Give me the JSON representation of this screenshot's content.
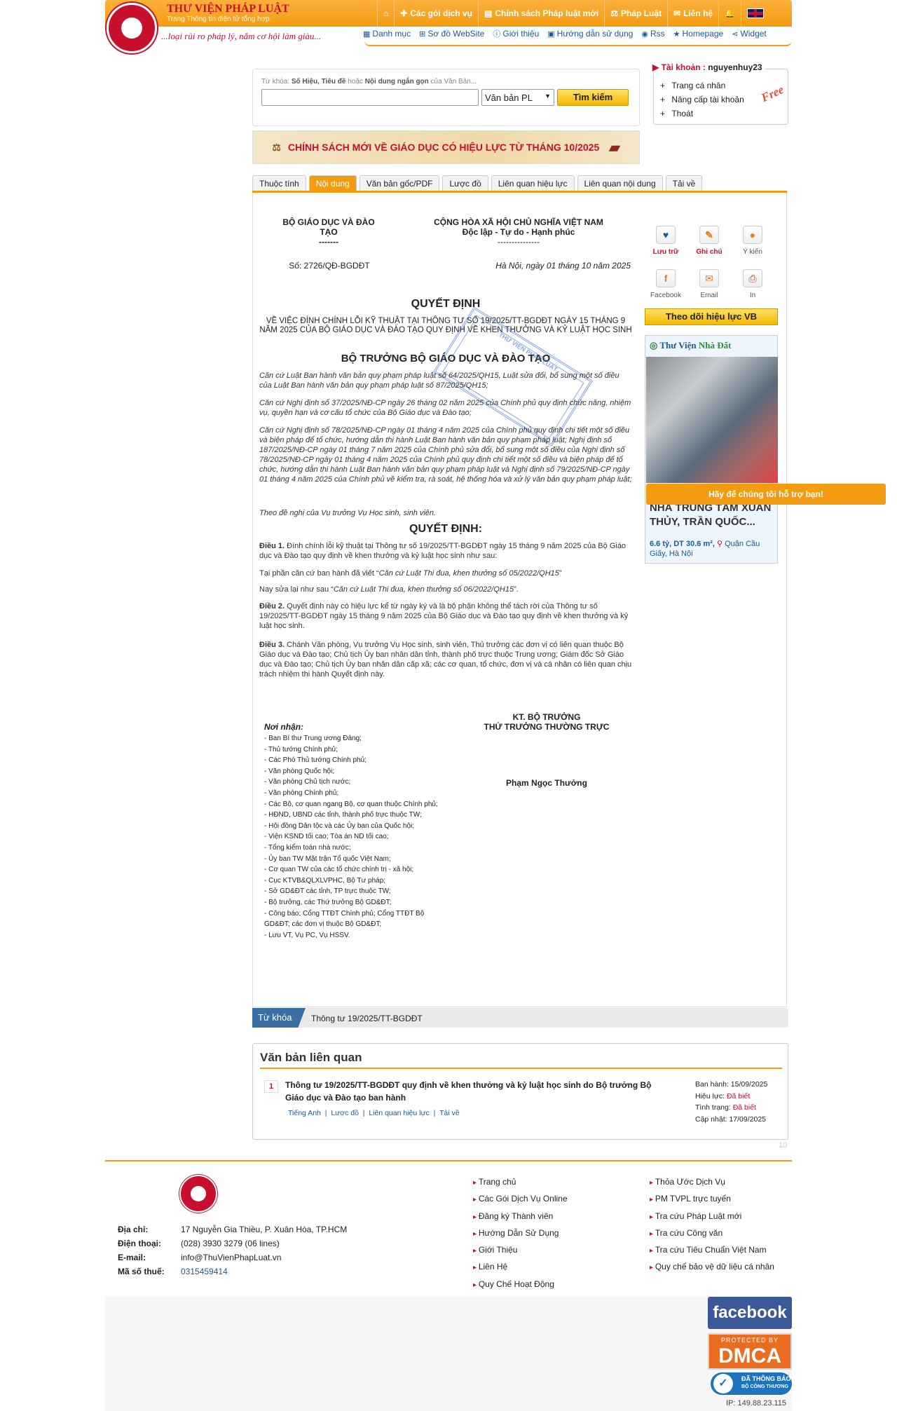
{
  "header": {
    "brand": "THƯ VIỆN PHÁP LUẬT",
    "brand_sub": "Trang Thông tin điện tử tổng hợp",
    "slogan": "...loại rủi ro pháp lý, nắm cơ hội làm giàu...",
    "top_nav": [
      "Các gói dịch vụ",
      "Chính sách Pháp luật mới",
      "Pháp Luật",
      "Liên hệ"
    ],
    "sub_nav": [
      "Danh mục",
      "Sơ đồ WebSite",
      "Giới thiệu",
      "Hướng dẫn sử dụng",
      "Rss",
      "Homepage",
      "Widget"
    ]
  },
  "search": {
    "hint_pre": "Từ khóa: ",
    "hint_b1": "Số Hiệu, Tiêu đề",
    "hint_mid": " hoặc ",
    "hint_b2": "Nội dung ngắn gọn",
    "hint_post": " của Văn Bản...",
    "type": "Văn bản PL",
    "button": "Tìm kiếm"
  },
  "account": {
    "label": "Tài khoản : ",
    "username": "nguyenhuy23",
    "items": [
      "Trang cá nhân",
      "Nâng cấp tài khoản",
      "Thoát"
    ],
    "free": "Free"
  },
  "banner": "CHÍNH SÁCH MỚI VỀ GIÁO DỤC CÓ HIỆU LỰC TỪ THÁNG 10/2025",
  "tabs": [
    "Thuộc tính",
    "Nội dung",
    "Văn bản gốc/PDF",
    "Lược đồ",
    "Liên quan hiệu lực",
    "Liên quan nội dung",
    "Tải về"
  ],
  "doc": {
    "org": "BỘ GIÁO DỤC VÀ ĐÀO TẠO",
    "org_sep": "-------",
    "nation": "CỘNG HÒA XÃ HỘI CHỦ NGHĨA VIỆT NAM",
    "motto": "Độc lập - Tự do - Hạnh phúc",
    "motto_sep": "---------------",
    "number": "Số: 2726/QĐ-BGDĐT",
    "date": "Hà Nội, ngày 01 tháng 10 năm 2025",
    "title": "QUYẾT ĐỊNH",
    "subtitle": "VỀ VIỆC ĐÍNH CHÍNH LỖI KỸ THUẬT TẠI THÔNG TƯ SỐ 19/2025/TT-BGDĐT NGÀY 15 THÁNG 9 NĂM 2025 CỦA BỘ GIÁO DỤC VÀ ĐÀO TẠO QUY ĐỊNH VỀ KHEN THƯỞNG VÀ KỶ LUẬT HỌC SINH",
    "authority": "BỘ TRƯỞNG BỘ GIÁO DỤC VÀ ĐÀO TẠO",
    "bases": [
      "Căn cứ Luật Ban hành văn bản quy phạm pháp luật số 64/2025/QH15, Luật sửa đổi, bổ sung một số điều của Luật Ban hành văn bản quy phạm pháp luật số 87/2025/QH15;",
      "Căn cứ Nghị định số 37/2025/NĐ-CP ngày 26 tháng 02 năm 2025 của Chính phủ quy định chức năng, nhiệm vụ, quyền hạn và cơ cấu tổ chức của Bộ Giáo dục và Đào tạo;",
      "Căn cứ Nghị định số 78/2025/NĐ-CP ngày 01 tháng 4 năm 2025 của Chính phủ quy định chi tiết một số điều và biện pháp để tổ chức, hướng dẫn thi hành Luật Ban hành văn bản quy phạm pháp luật; Nghị định số 187/2025/NĐ-CP ngày 01 tháng 7 năm 2025 của Chính phủ sửa đổi, bổ sung một số điều của Nghị định số 78/2025/NĐ-CP ngày 01 tháng 4 năm 2025 của Chính phủ quy định chi tiết một số điều và biện pháp để tổ chức, hướng dẫn thi hành Luật Ban hành văn bản quy phạm pháp luật và Nghị định số 79/2025/NĐ-CP ngày 01 tháng 4 năm 2025 của Chính phủ về kiểm tra, rà soát, hệ thống hóa và xử lý văn bản quy phạm pháp luật;",
      "Theo đề nghị của Vụ trưởng Vụ Học sinh, sinh viên."
    ],
    "decide": "QUYẾT ĐỊNH:",
    "art1_label": "Điều 1.",
    "art1": " Đính chính lỗi kỹ thuật tại Thông tư số 19/2025/TT-BGDĐT ngày 15 tháng 9 năm 2025 của Bộ Giáo dục và Đào tạo quy định về khen thưởng và kỷ luật học sinh như sau:",
    "art1_a_pre": "Tại phần căn cứ ban hành đã viết “",
    "art1_a_it": "Căn cứ Luật Thi đua, khen thưởng số 05/2022/QH15",
    "art1_a_post": "”",
    "art1_b_pre": "Nay sửa lại như sau “",
    "art1_b_it": "Căn cứ Luật Thi đua, khen thưởng số 06/2022/QH15",
    "art1_b_post": "”.",
    "art2_label": "Điều 2.",
    "art2": " Quyết định này có hiệu lực kể từ ngày ký và là bộ phận không thể tách rời của Thông tư số 19/2025/TT-BGDĐT ngày 15 tháng 9 năm 2025 của Bộ Giáo dục và Đào tạo quy định về khen thưởng và kỷ luật học sinh.",
    "art3_label": "Điều 3.",
    "art3": " Chánh Văn phòng, Vụ trưởng Vụ Học sinh, sinh viên, Thủ trưởng các đơn vị có liên quan thuộc Bộ Giáo dục và Đào tạo; Chủ tịch Ủy ban nhân dân tỉnh, thành phố trực thuộc Trung ương; Giám đốc Sở Giáo dục và Đào tạo; Chủ tịch Ủy ban nhân dân cấp xã; các cơ quan, tổ chức, đơn vị và cá nhân có liên quan chịu trách nhiệm thi hành Quyết định này.",
    "stamp": "THƯ VIỆN PHÁP LUẬT",
    "sign_1": "KT. BỘ TRƯỞNG",
    "sign_2": "THỨ TRƯỞNG THƯỜNG TRỰC",
    "signer": "Phạm Ngọc Thưởng",
    "recv_title": "Nơi nhận:",
    "recipients": [
      "- Ban Bí thư Trung ương Đảng;",
      "- Thủ tướng Chính phủ;",
      "- Các Phó Thủ tướng Chính phủ;",
      "- Văn phòng Quốc hội;",
      "- Văn phòng Chủ tịch nước;",
      "- Văn phòng Chính phủ;",
      "- Các Bộ, cơ quan ngang Bộ, cơ quan thuộc Chính phủ;",
      "- HĐND, UBND các tỉnh, thành phố trực thuộc TW;",
      "- Hội đồng Dân tộc và các Ủy ban của Quốc hội;",
      "- Viện KSND tối cao; Tòa án ND tối cao;",
      "- Tổng kiểm toán nhà nước;",
      "- Ủy ban TW Mặt trận Tổ quốc Việt Nam;",
      "- Cơ quan TW của các tổ chức chính trị - xã hội;",
      "- Cục KTVB&QLXLVPHC, Bộ Tư pháp;",
      "- Sở GD&ĐT các tỉnh, TP trực thuộc TW;",
      "- Bộ trưởng, các Thứ trưởng Bộ GD&ĐT;",
      "- Công báo; Cổng TTĐT Chính phủ; Cổng TTĐT Bộ GD&ĐT; các đơn vị thuộc Bộ GD&ĐT;",
      "- Lưu VT, Vụ PC, Vụ HSSV."
    ]
  },
  "tools": {
    "items": [
      "Lưu trữ",
      "Ghi chú",
      "Ý kiến",
      "Facebook",
      "Email",
      "In"
    ],
    "follow": "Theo dõi hiệu lực VB"
  },
  "ad": {
    "brand_1": "Thư Viện ",
    "brand_2": "Nhà Đất",
    "title": "NHÀ TRUNG TÂM XUÂN THỦY, TRẦN QUỐC...",
    "price": "6.6 tỷ, DT 30.6 m²,",
    "location": "Quận Cầu Giấy, Hà Nội",
    "help": "Hãy để chúng tôi hỗ trợ bạn!"
  },
  "keyword": {
    "label": "Từ khóa",
    "value": "Thông tư 19/2025/TT-BGDĐT"
  },
  "related": {
    "heading": "Văn bản liên quan",
    "items": [
      {
        "no": "1",
        "title": "Thông tư 19/2025/TT-BGDĐT quy định về khen thưởng và kỷ luật học sinh do Bộ trưởng Bộ Giáo dục và Đào tạo ban hành",
        "links": [
          "Tiếng Anh",
          "Lược đồ",
          "Liên quan hiệu lực",
          "Tải về"
        ],
        "issued_label": "Ban hành: ",
        "issued": "15/09/2025",
        "effect_label": "Hiệu lực: ",
        "effect": "Đã biết",
        "status_label": "Tình trạng: ",
        "status": "Đã biết",
        "updated_label": "Cập nhật: ",
        "updated": "17/09/2025"
      }
    ],
    "page_count": "10"
  },
  "footer": {
    "address_label": "Địa chỉ:",
    "address": "17 Nguyễn Gia Thiều, P. Xuân Hòa, TP.HCM",
    "phone_label": "Điện thoại:",
    "phone": "(028) 3930 3279 (06 lines)",
    "email_label": "E-mail:",
    "email": "info@ThuVienPhapLuat.vn",
    "tax_label": "Mã số thuế:",
    "tax": "0315459414",
    "col1": [
      "Trang chủ",
      "Các Gói Dịch Vụ Online",
      "Đăng ký Thành viên",
      "Hướng Dẫn Sử Dụng",
      "Giới Thiệu",
      "Liên Hệ",
      "Quy Chế Hoạt Động"
    ],
    "col2": [
      "Thỏa Ước Dịch Vụ",
      "PM TVPL trực tuyến",
      "Tra cứu Pháp Luật mới",
      "Tra cứu Công văn",
      "Tra cứu Tiêu Chuẩn Việt Nam",
      "Quy chế bảo vệ dữ liệu cá nhân"
    ],
    "facebook": "facebook",
    "dmca_top": "PROTECTED BY",
    "dmca": "DMCA",
    "bct_1": "ĐÃ THÔNG BÁO",
    "bct_2": "BỘ CÔNG THƯƠNG",
    "ip": "IP: 149.88.23.115"
  }
}
